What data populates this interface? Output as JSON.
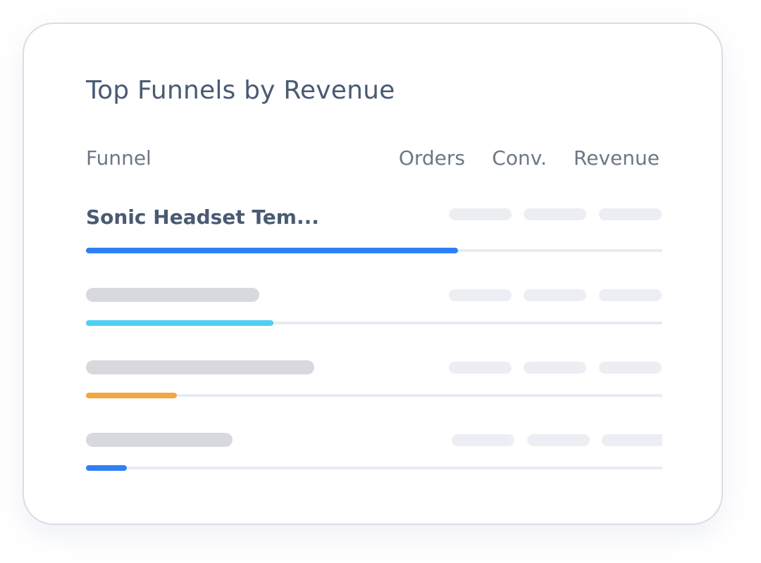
{
  "card": {
    "title": "Top Funnels by Revenue"
  },
  "table": {
    "columns": {
      "funnel": "Funnel",
      "orders": "Orders",
      "conversion": "Conv.",
      "revenue": "Revenue"
    },
    "rows": [
      {
        "name": "Sonic Headset Tem...",
        "revenue_share": 0.646,
        "bar_color": "#2f80f6",
        "loading": false
      },
      {
        "name": null,
        "revenue_share": 0.325,
        "bar_color": "#4dd0f2",
        "loading": true
      },
      {
        "name": null,
        "revenue_share": 0.158,
        "bar_color": "#f2a540",
        "loading": true
      },
      {
        "name": null,
        "revenue_share": 0.071,
        "bar_color": "#2f80f6",
        "loading": true
      }
    ]
  },
  "colors": {
    "title_text": "#4a5a73",
    "header_text": "#6d7785",
    "placeholder_name": "#d8d9de",
    "placeholder_cell": "#eceef3",
    "track": "#e8ebf3",
    "card_border": "#dadde3"
  }
}
